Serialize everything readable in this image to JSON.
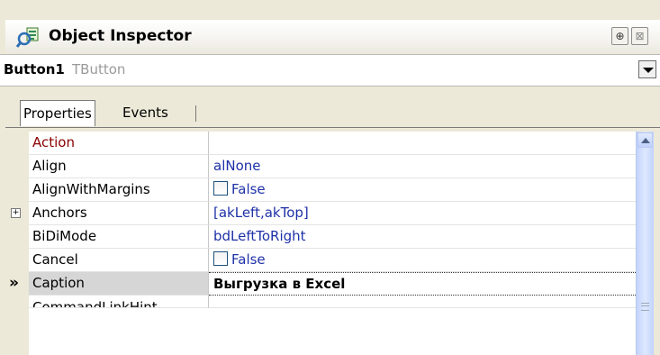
{
  "window": {
    "title": "Object Inspector",
    "title_icon": "object-inspector-icon",
    "pin_glyph": "⊕",
    "close_glyph": "⊠"
  },
  "object_selector": {
    "name": "Button1",
    "type": "TButton"
  },
  "tabs": [
    {
      "label": "Properties",
      "active": true
    },
    {
      "label": "Events",
      "active": false
    }
  ],
  "properties": [
    {
      "name": "Action",
      "value": "",
      "name_color": "#8b0000"
    },
    {
      "name": "Align",
      "value": "alNone"
    },
    {
      "name": "AlignWithMargins",
      "value": "False",
      "checkbox": true
    },
    {
      "name": "Anchors",
      "value": "[akLeft,akTop]",
      "expandable": true
    },
    {
      "name": "BiDiMode",
      "value": "bdLeftToRight"
    },
    {
      "name": "Cancel",
      "value": "False",
      "checkbox": true
    },
    {
      "name": "Caption",
      "value": "Выгрузка в Excel",
      "selected": true
    },
    {
      "name": "CommandLinkHint",
      "value": ""
    }
  ],
  "selected_marker": "»",
  "colors": {
    "value_text": "#1f31a7",
    "reference_property": "#8b0000",
    "scrollbar": "#c3d3fd"
  }
}
